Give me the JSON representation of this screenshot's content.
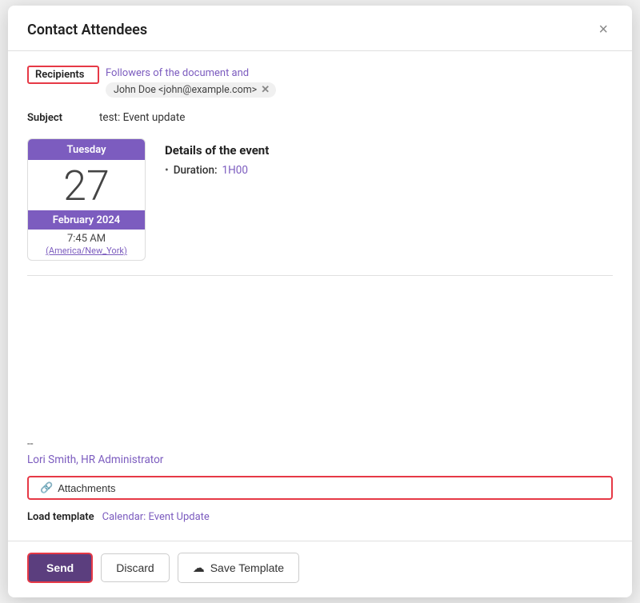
{
  "dialog": {
    "title": "Contact Attendees",
    "close_label": "×"
  },
  "recipients": {
    "label": "Recipients",
    "followers_text": "Followers of the document and",
    "tag_text": "John Doe <john@example.com>",
    "tag_close": "✕"
  },
  "subject": {
    "label": "Subject",
    "value": "test: Event update"
  },
  "calendar": {
    "day_name": "Tuesday",
    "day_number": "27",
    "month_year": "February 2024",
    "time": "7:45 AM",
    "timezone": "(America/New_York)"
  },
  "event_details": {
    "title": "Details of the event",
    "duration_label": "Duration:",
    "duration_value": "1H00"
  },
  "signature": {
    "separator": "--",
    "name": "Lori Smith, HR Administrator"
  },
  "attachments": {
    "label": "Attachments",
    "icon": "🔗"
  },
  "load_template": {
    "label": "Load template",
    "value": "Calendar: Event Update"
  },
  "footer": {
    "send_label": "Send",
    "discard_label": "Discard",
    "save_template_label": "Save Template",
    "save_icon": "☁"
  }
}
